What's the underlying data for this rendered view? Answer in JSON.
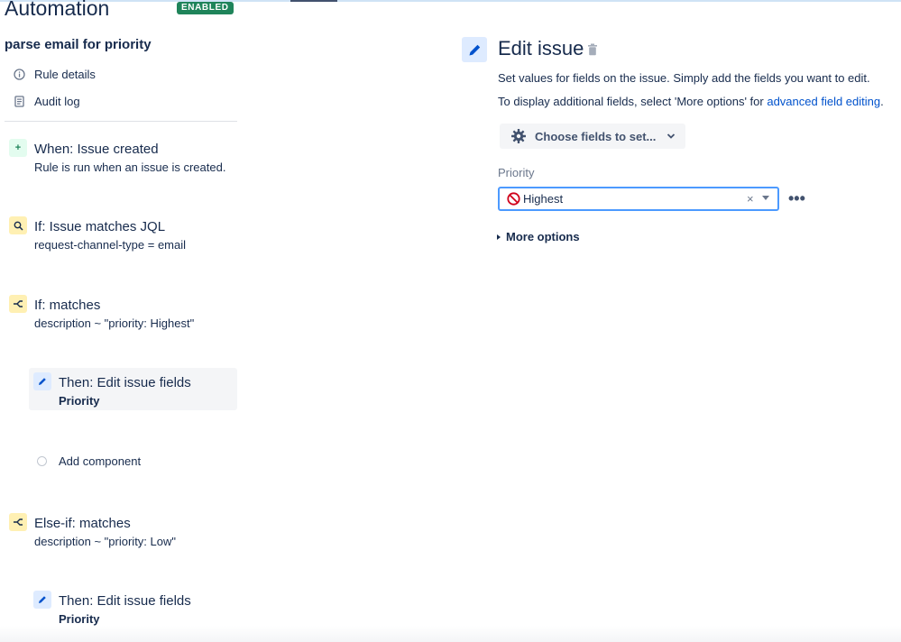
{
  "app": {
    "title": "Automation",
    "status_badge": "ENABLED"
  },
  "rule": {
    "name": "parse email for priority"
  },
  "nav": {
    "rule_details": "Rule details",
    "audit_log": "Audit log"
  },
  "components": {
    "trigger": {
      "title": "When: Issue created",
      "subtitle": "Rule is run when an issue is created."
    },
    "jql_condition": {
      "title": "If: Issue matches JQL",
      "subtitle": "request-channel-type = email"
    },
    "if_matches": {
      "title": "If: matches",
      "subtitle": "description ~ \"priority: Highest\""
    },
    "then_edit_1": {
      "title": "Then: Edit issue fields",
      "subtitle": "Priority"
    },
    "add_component": "Add component",
    "else_if_matches": {
      "title": "Else-if: matches",
      "subtitle": "description ~ \"priority: Low\""
    },
    "then_edit_2": {
      "title": "Then: Edit issue fields",
      "subtitle": "Priority"
    }
  },
  "editor": {
    "title": "Edit issue",
    "description": "Set values for fields on the issue. Simply add the fields you want to edit.",
    "description2_prefix": "To display additional fields, select 'More options' for ",
    "description2_link": "advanced field editing",
    "description2_suffix": ".",
    "choose_fields_label": "Choose fields to set...",
    "priority_label": "Priority",
    "priority_value": "Highest",
    "clear_symbol": "×",
    "more_dots": "•••",
    "more_options_label": "More options"
  },
  "colors": {
    "badge": "#1f845a",
    "link": "#0052cc",
    "focus_border": "#4c9aff",
    "priority_highest": "#d0021b"
  },
  "icons": {
    "rule_details": "info-icon",
    "audit_log": "document-icon",
    "trigger": "plus-icon",
    "jql": "search-icon",
    "branch": "branch-icon",
    "edit": "pencil-icon",
    "trash": "trash-icon",
    "gear": "gear-icon",
    "priority": "blocker-icon"
  }
}
